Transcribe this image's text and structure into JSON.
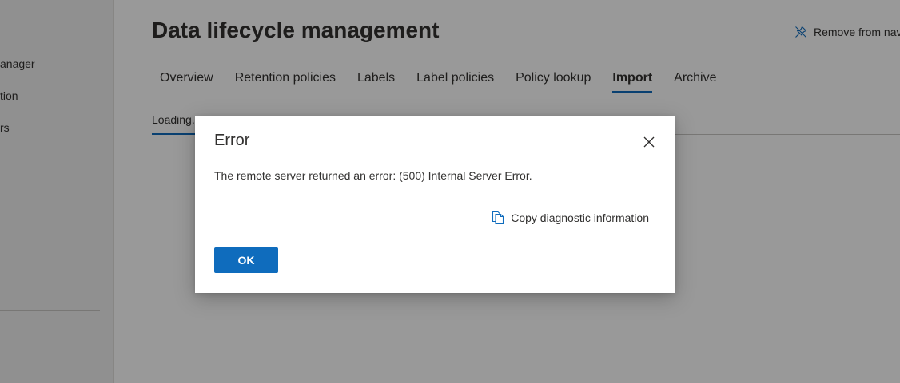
{
  "left_nav": {
    "items": [
      {
        "label": "anager"
      },
      {
        "label": "tion"
      },
      {
        "label": "rs"
      }
    ]
  },
  "header": {
    "title": "Data lifecycle management",
    "remove_from_nav": "Remove from nav"
  },
  "tabs": [
    {
      "label": "Overview"
    },
    {
      "label": "Retention policies"
    },
    {
      "label": "Labels"
    },
    {
      "label": "Label policies"
    },
    {
      "label": "Policy lookup"
    },
    {
      "label": "Import",
      "active": true
    },
    {
      "label": "Archive"
    }
  ],
  "subbar": {
    "loading": "Loading..."
  },
  "dialog": {
    "title": "Error",
    "message": "The remote server returned an error: (500) Internal Server Error.",
    "copy_link": "Copy diagnostic information",
    "ok_label": "OK"
  },
  "colors": {
    "accent": "#0f6cbd",
    "text": "#323130",
    "overlay": "rgba(0,0,0,0.4)"
  },
  "icons": {
    "remove_from_nav": "unpin-icon",
    "close": "close-icon",
    "copy": "copy-icon"
  }
}
